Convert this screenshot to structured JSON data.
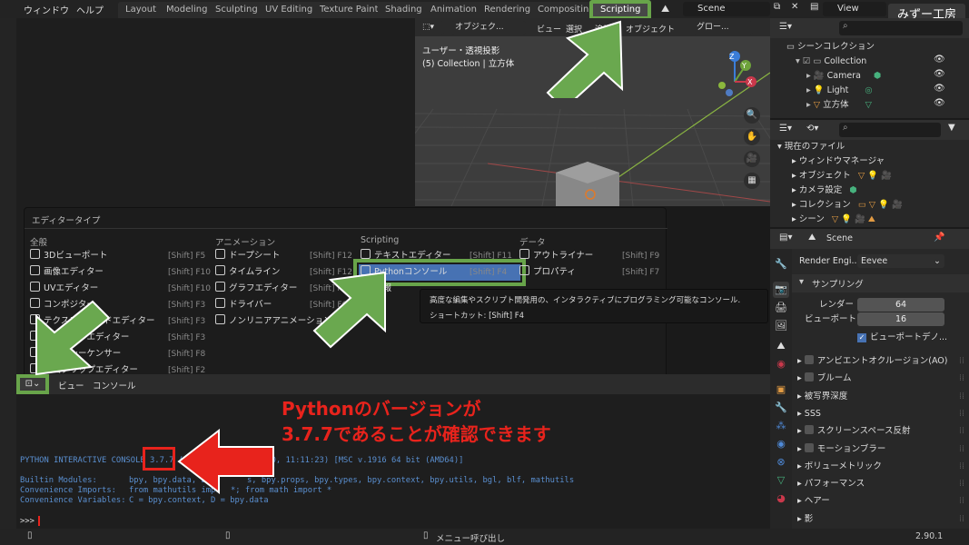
{
  "topbar": {
    "menus": [
      "ウィンドウ",
      "ヘルプ"
    ],
    "workspace_tabs": [
      "Layout",
      "Modeling",
      "Sculpting",
      "UV Editing",
      "Texture Paint",
      "Shading",
      "Animation",
      "Rendering",
      "Compositing",
      "Scripting"
    ],
    "active_tab": "Scripting",
    "scene_name": "Scene",
    "view_layer": "View Layer"
  },
  "watermark": "みずー工房",
  "viewport": {
    "mode_label": "オブジェク...",
    "view_label": "ビュー",
    "select_label": "選択",
    "add_label": "追加",
    "object_label": "オブジェクト",
    "orientation_label": "グロー...",
    "overlay_title": "ユーザー・透視投影",
    "overlay_sub": "(5) Collection | 立方体",
    "gizmo": {
      "z": "Z",
      "y": "Y",
      "x": "X"
    }
  },
  "outliner": {
    "root": "シーンコレクション",
    "items": [
      {
        "name": "Collection",
        "indent": 1,
        "icon": "collection-icon"
      },
      {
        "name": "Camera",
        "indent": 2,
        "icon": "camera-icon"
      },
      {
        "name": "Light",
        "indent": 2,
        "icon": "light-icon"
      },
      {
        "name": "立方体",
        "indent": 2,
        "icon": "mesh-icon"
      }
    ]
  },
  "filebrowser": {
    "root": "現在のファイル",
    "items": [
      "ウィンドウマネージャ",
      "オブジェクト",
      "カメラ設定",
      "コレクション",
      "シーン"
    ]
  },
  "properties": {
    "scene_label": "Scene",
    "render_engine_label": "Render Engi...",
    "render_engine_value": "Eevee",
    "sampling_header": "サンプリング",
    "render_label": "レンダー",
    "render_value": "64",
    "viewport_label": "ビューポート",
    "viewport_value": "16",
    "viewport_denoise": "ビューポートデノ...",
    "sections": [
      {
        "label": "アンビエントオクルージョン(AO)",
        "checkbox": true
      },
      {
        "label": "ブルーム",
        "checkbox": true
      },
      {
        "label": "被写界深度",
        "checkbox": false
      },
      {
        "label": "SSS",
        "checkbox": false
      },
      {
        "label": "スクリーンスペース反射",
        "checkbox": true
      },
      {
        "label": "モーションブラー",
        "checkbox": true
      },
      {
        "label": "ボリューメトリック",
        "checkbox": false
      },
      {
        "label": "パフォーマンス",
        "checkbox": false
      },
      {
        "label": "ヘアー",
        "checkbox": false
      },
      {
        "label": "影",
        "checkbox": false
      }
    ]
  },
  "editor_type_menu": {
    "title": "エディタータイプ",
    "columns": [
      {
        "header": "全般",
        "items": [
          {
            "label": "3Dビューポート",
            "shortcut": "[Shift] F5"
          },
          {
            "label": "画像エディター",
            "shortcut": "[Shift] F10"
          },
          {
            "label": "UVエディター",
            "shortcut": "[Shift] F10"
          },
          {
            "label": "コンポジター",
            "shortcut": "[Shift] F3"
          },
          {
            "label": "テクスチャノードエディター",
            "shortcut": "[Shift] F3"
          },
          {
            "label": "シェーダーエディター",
            "shortcut": "[Shift] F3"
          },
          {
            "label": "ビデオシーケンサー",
            "shortcut": "[Shift] F8"
          },
          {
            "label": "動画クリップエディター",
            "shortcut": "[Shift] F2"
          }
        ]
      },
      {
        "header": "アニメーション",
        "items": [
          {
            "label": "ドープシート",
            "shortcut": "[Shift] F12"
          },
          {
            "label": "タイムライン",
            "shortcut": "[Shift] F12"
          },
          {
            "label": "グラフエディター",
            "shortcut": "[Shift] F6"
          },
          {
            "label": "ドライバー",
            "shortcut": "[Shift] F6"
          },
          {
            "label": "ノンリニアアニメーション",
            "shortcut": ""
          }
        ]
      },
      {
        "header": "Scripting",
        "items": [
          {
            "label": "テキストエディター",
            "shortcut": "[Shift] F11"
          },
          {
            "label": "Pythonコンソール",
            "shortcut": "[Shift] F4"
          },
          {
            "label": "情報",
            "shortcut": ""
          }
        ]
      },
      {
        "header": "データ",
        "items": [
          {
            "label": "アウトライナー",
            "shortcut": "[Shift] F9"
          },
          {
            "label": "プロパティ",
            "shortcut": "[Shift] F7"
          }
        ]
      }
    ]
  },
  "tooltip": {
    "line1": "高度な編集やスクリプト開発用の、インタラクティブにプログラミング可能なコンソール.",
    "line2": "ショートカット: [Shift] F4"
  },
  "console": {
    "header_view": "ビュー",
    "header_console": "コンソール",
    "line_version_prefix": "PYTHON INTERACTIVE CONSOLE ",
    "version": "3.7.7",
    "line_version_suffix": " (d",
    "line_version_tail": "020, 11:11:23) [MSC v.1916 64 bit (AMD64)]",
    "builtin_label": "Builtin Modules:",
    "builtin_value": "bpy, bpy.data, bp",
    "builtin_value2": "s, bpy.props, bpy.types, bpy.context, bpy.utils, bgl, blf, mathutils",
    "imports_label": "Convenience Imports:",
    "imports_value": "from mathutils impo",
    "imports_value2": "*; from math import *",
    "vars_label": "Convenience Variables:",
    "vars_value": "C = bpy.context, D = bpy.data",
    "prompt": ">>>"
  },
  "annotation": {
    "line1": "Pythonのバージョンが",
    "line2": "3.7.7であることが確認できます"
  },
  "status": {
    "center": "メニュー呼び出し",
    "version": "2.90.1"
  },
  "colors": {
    "accent_green": "#68a44a",
    "accent_red": "#e8231c",
    "selection_blue": "#4772b3"
  }
}
